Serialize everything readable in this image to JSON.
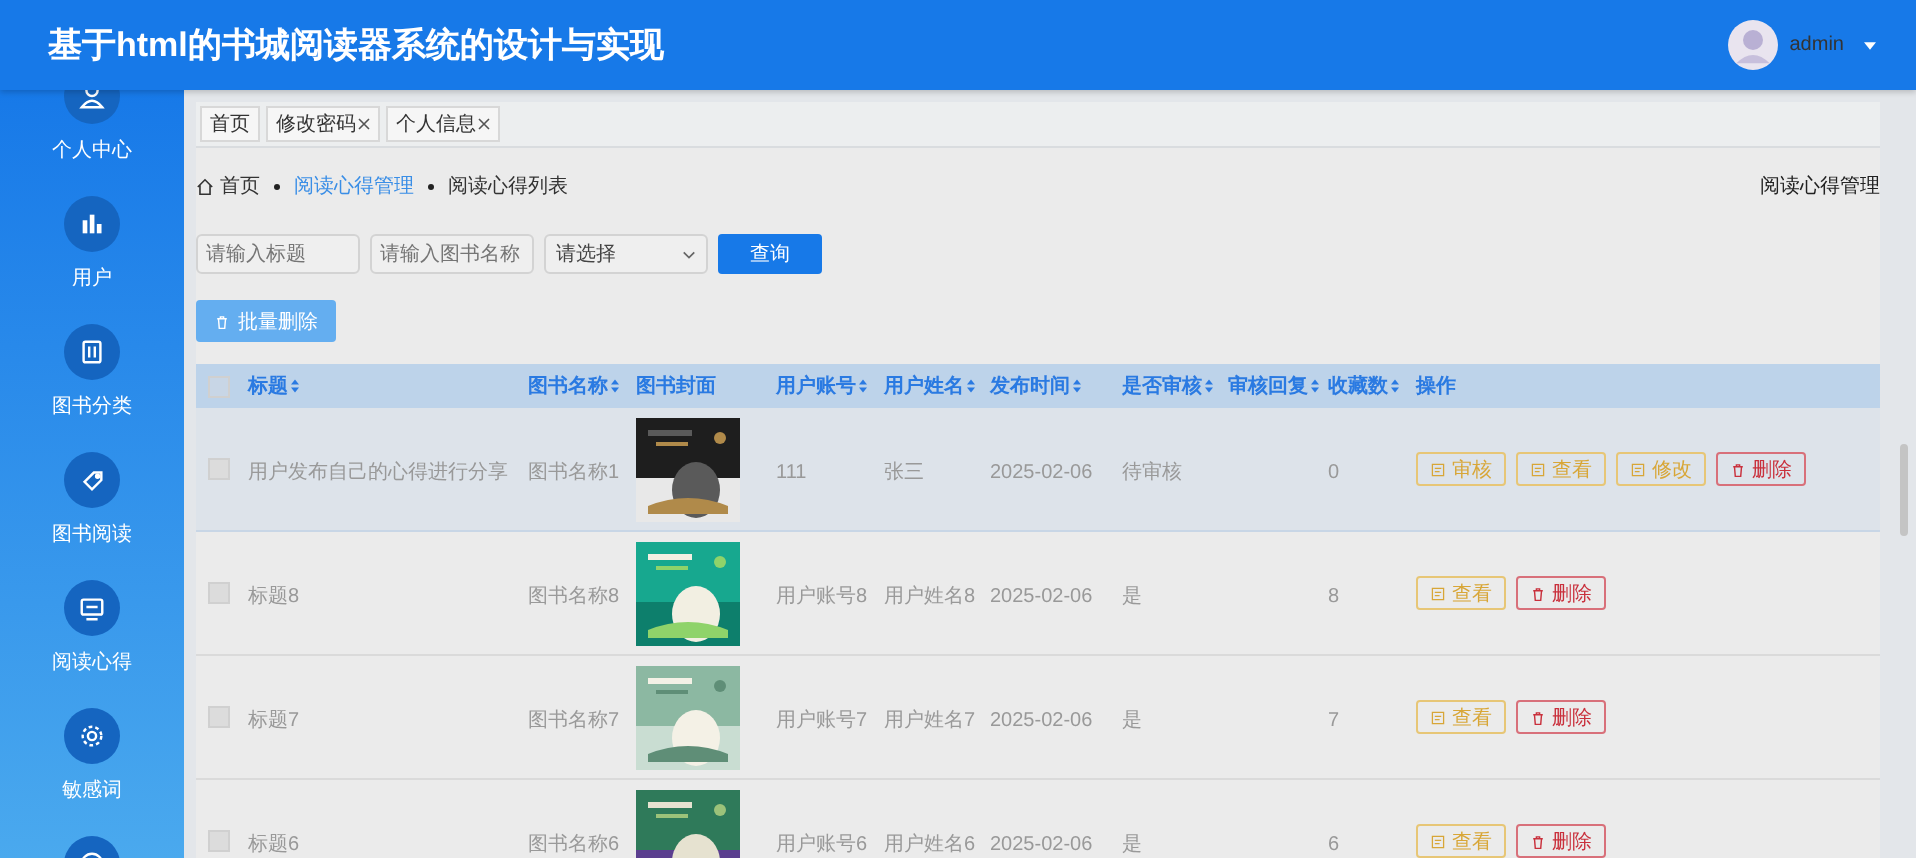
{
  "header": {
    "title": "基于html的书城阅读器系统的设计与实现",
    "user": "admin"
  },
  "sidebar": {
    "items": [
      {
        "kind": "labeled",
        "label": "个人中心"
      },
      {
        "kind": "labeled",
        "label": "用户"
      },
      {
        "kind": "labeled",
        "label": "图书分类"
      },
      {
        "kind": "labeled",
        "label": "图书阅读"
      },
      {
        "kind": "labeled",
        "label": "阅读心得"
      },
      {
        "kind": "labeled",
        "label": "敏感词"
      },
      {
        "kind": "icon_only"
      }
    ]
  },
  "tabs": [
    {
      "label": "首页",
      "closable": false
    },
    {
      "label": "修改密码",
      "closable": true
    },
    {
      "label": "个人信息",
      "closable": true
    }
  ],
  "breadcrumb": [
    {
      "label": "首页",
      "link": false,
      "home": true
    },
    {
      "label": "阅读心得管理",
      "link": true,
      "home": false
    },
    {
      "label": "阅读心得列表",
      "link": false,
      "home": false
    }
  ],
  "page_title": "阅读心得管理",
  "filters": {
    "title_placeholder": "请输入标题",
    "book_placeholder": "请输入图书名称",
    "select_value": "请选择",
    "search_button": "查询"
  },
  "batch_delete": {
    "label": "批量删除",
    "disabled": true
  },
  "table": {
    "select_all": {
      "checked": false
    },
    "columns": [
      {
        "label": "标题",
        "sortable": true
      },
      {
        "label": "图书名称",
        "sortable": true
      },
      {
        "label": "图书封面",
        "sortable": false
      },
      {
        "label": "用户账号",
        "sortable": true
      },
      {
        "label": "用户姓名",
        "sortable": true
      },
      {
        "label": "发布时间",
        "sortable": true
      },
      {
        "label": "是否审核",
        "sortable": true
      },
      {
        "label": "审核回复",
        "sortable": true
      },
      {
        "label": "收藏数",
        "sortable": true
      },
      {
        "label": "操作",
        "sortable": false
      }
    ],
    "rows": [
      {
        "checked": false,
        "highlighted": true,
        "title": "用户发布自己的心得进行分享",
        "book": "图书名称1",
        "cover": {
          "kind": "picture"
        },
        "account": "111",
        "name": "张三",
        "date": "2025-02-06",
        "reviewed": "待审核",
        "favorites": "0",
        "actions": [
          {
            "kind": "review",
            "label": "审核"
          },
          {
            "kind": "view",
            "label": "查看"
          },
          {
            "kind": "edit",
            "label": "修改"
          },
          {
            "kind": "delete",
            "label": "删除"
          }
        ]
      },
      {
        "checked": false,
        "highlighted": false,
        "title": "标题8",
        "book": "图书名称8",
        "cover": {
          "kind": "picture"
        },
        "account": "用户账号8",
        "name": "用户姓名8",
        "date": "2025-02-06",
        "reviewed": "是",
        "favorites": "8",
        "actions": [
          {
            "kind": "view",
            "label": "查看"
          },
          {
            "kind": "delete",
            "label": "删除"
          }
        ]
      },
      {
        "checked": false,
        "highlighted": false,
        "title": "标题7",
        "book": "图书名称7",
        "cover": {
          "kind": "picture"
        },
        "account": "用户账号7",
        "name": "用户姓名7",
        "date": "2025-02-06",
        "reviewed": "是",
        "favorites": "7",
        "actions": [
          {
            "kind": "view",
            "label": "查看"
          },
          {
            "kind": "delete",
            "label": "删除"
          }
        ]
      },
      {
        "checked": false,
        "highlighted": false,
        "title": "标题6",
        "book": "图书名称6",
        "cover": {
          "kind": "picture"
        },
        "account": "用户账号6",
        "name": "用户姓名6",
        "date": "2025-02-06",
        "reviewed": "是",
        "favorites": "6",
        "actions": [
          {
            "kind": "view",
            "label": "查看"
          },
          {
            "kind": "delete",
            "label": "删除"
          }
        ]
      }
    ]
  }
}
